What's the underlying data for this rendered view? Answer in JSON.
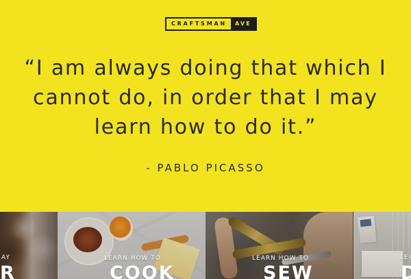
{
  "brand": {
    "logo_main": "CRAFTSMAN",
    "logo_suffix": "AVE"
  },
  "hero": {
    "quote_lines": [
      "“I am always doing that which I",
      "cannot do, in order that I may",
      "learn how to do it.”"
    ],
    "author": "- PABLO PICASSO"
  },
  "categories": [
    {
      "partial_small": "AY",
      "partial_big": "R"
    },
    {
      "small_label": "LEARN HOW TO",
      "big_label": "COOK"
    },
    {
      "small_label": "LEARN HOW TO",
      "big_label": "SEW"
    },
    {
      "partial_small": "LEAR",
      "partial_big": "D"
    }
  ],
  "colors": {
    "background": "#f3e31f",
    "text": "#2a2925",
    "logo_dark": "#1d1d1d"
  }
}
